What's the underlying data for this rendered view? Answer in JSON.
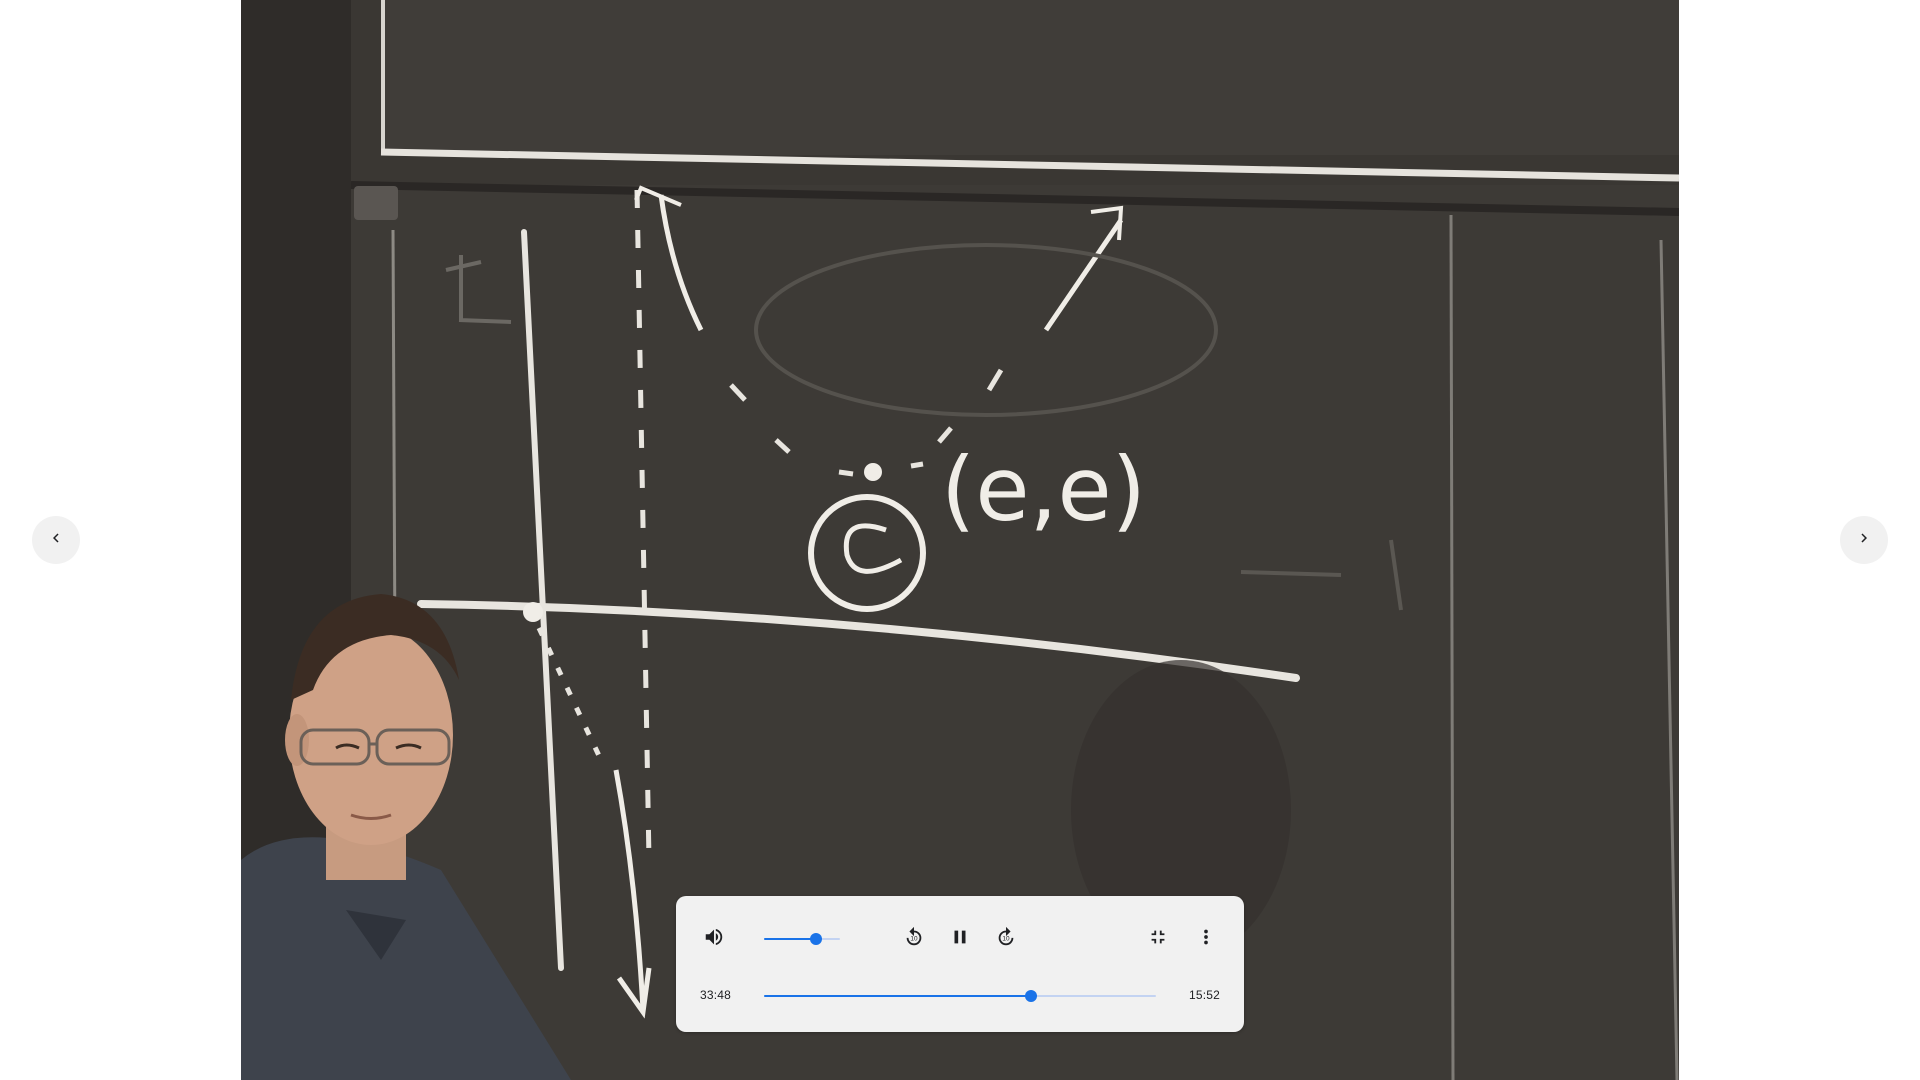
{
  "navigation": {
    "prev_icon": "chevron-left-icon",
    "next_icon": "chevron-right-icon"
  },
  "video": {
    "board_equation": "(e,e)"
  },
  "player": {
    "volume_icon": "volume-up-icon",
    "volume_level": 0.68,
    "rewind_icon": "replay-10-icon",
    "pause_icon": "pause-icon",
    "forward_icon": "forward-10-icon",
    "exit_fullscreen_icon": "fullscreen-exit-icon",
    "more_icon": "more-vert-icon",
    "current_time": "33:48",
    "remaining_time": "15:52",
    "progress": 0.68
  },
  "colors": {
    "accent": "#1a73e8",
    "panel": "#f1f1f1",
    "page_background": "#ffffff"
  }
}
